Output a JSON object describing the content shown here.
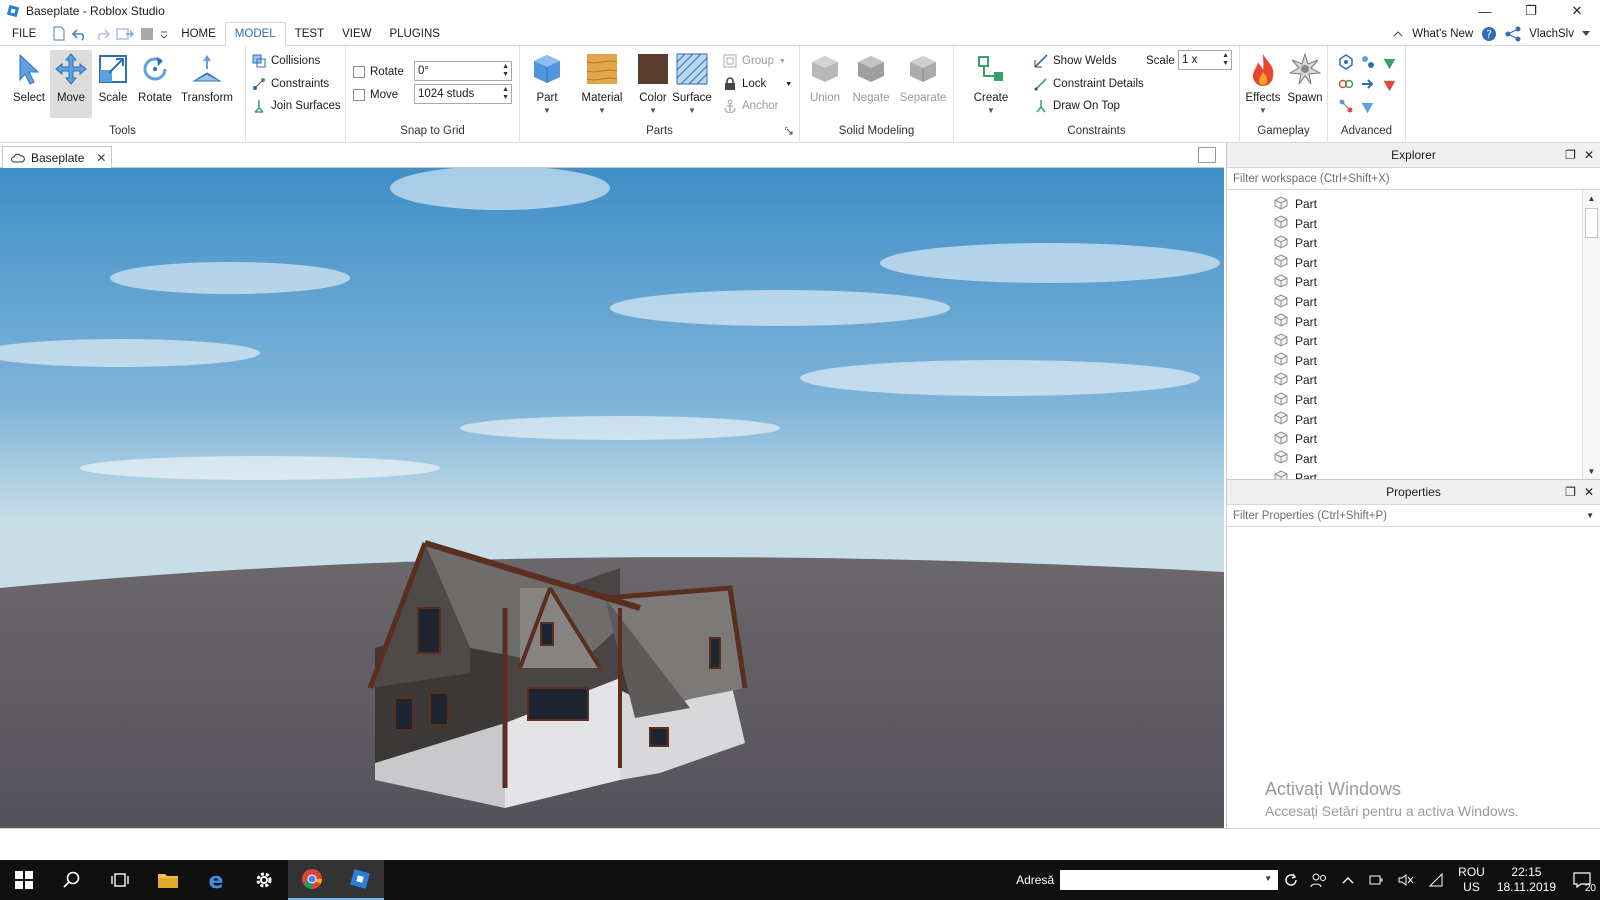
{
  "window": {
    "title": "Baseplate - Roblox Studio",
    "min_symbol": "—",
    "restore_symbol": "❐",
    "close_symbol": "✕"
  },
  "tabs": {
    "file": "FILE",
    "items": [
      "HOME",
      "MODEL",
      "TEST",
      "VIEW",
      "PLUGINS"
    ],
    "active": "MODEL",
    "whats_new": "What's New",
    "user": "VlachSlv"
  },
  "ribbon": {
    "tools": {
      "label": "Tools",
      "buttons": [
        "Select",
        "Move",
        "Scale",
        "Rotate",
        "Transform"
      ],
      "options": [
        "Collisions",
        "Constraints",
        "Join Surfaces"
      ]
    },
    "snap": {
      "label": "Snap to Grid",
      "rotate_label": "Rotate",
      "rotate_value": "0°",
      "move_label": "Move",
      "move_value": "1024 studs"
    },
    "parts": {
      "label": "Parts",
      "buttons": [
        "Part",
        "Material",
        "Color",
        "Surface"
      ],
      "group": "Group",
      "lock": "Lock",
      "anchor": "Anchor"
    },
    "solid": {
      "label": "Solid Modeling",
      "buttons": [
        "Union",
        "Negate",
        "Separate"
      ]
    },
    "constraints": {
      "label": "Constraints",
      "create": "Create",
      "show_welds": "Show Welds",
      "constraint_details": "Constraint Details",
      "draw_on_top": "Draw On Top",
      "scale_label": "Scale",
      "scale_value": "1 x"
    },
    "gameplay": {
      "label": "Gameplay",
      "buttons": [
        "Effects",
        "Spawn"
      ]
    },
    "advanced": {
      "label": "Advanced"
    }
  },
  "document": {
    "tab": "Baseplate",
    "close": "✕"
  },
  "explorer": {
    "title": "Explorer",
    "filter_placeholder": "Filter workspace (Ctrl+Shift+X)",
    "items": [
      "Part",
      "Part",
      "Part",
      "Part",
      "Part",
      "Part",
      "Part",
      "Part",
      "Part",
      "Part",
      "Part",
      "Part",
      "Part",
      "Part",
      "Part"
    ]
  },
  "properties": {
    "title": "Properties",
    "filter_placeholder": "Filter Properties (Ctrl+Shift+P)"
  },
  "watermark": {
    "line1": "Activați Windows",
    "line2": "Accesați Setări pentru a activa Windows."
  },
  "taskbar": {
    "address_label": "Adresă",
    "lang_top": "ROU",
    "lang_bottom": "US",
    "time": "22:15",
    "date": "18.11.2019",
    "notifications": "20"
  },
  "colors": {
    "accent": "#2f6fb5",
    "sky_top": "#3f8fc8",
    "sky_bottom": "#c7dde8",
    "baseplate": "#5c595d",
    "taskbar": "#101010"
  }
}
